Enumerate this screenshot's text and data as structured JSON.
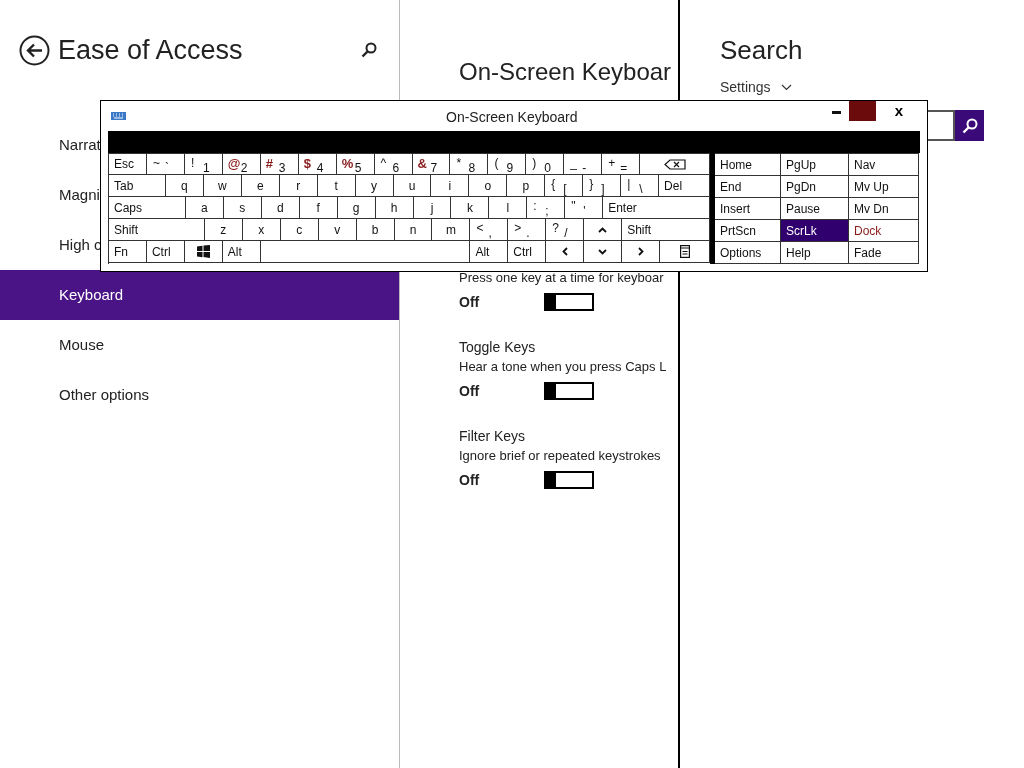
{
  "left_panel": {
    "title": "Ease of Access",
    "items": [
      {
        "label": "Narrat",
        "selected": false
      },
      {
        "label": "Magni",
        "selected": false
      },
      {
        "label": "High c",
        "selected": false
      },
      {
        "label": "Keyboard",
        "selected": true
      },
      {
        "label": "Mouse",
        "selected": false
      },
      {
        "label": "Other options",
        "selected": false
      }
    ]
  },
  "middle_panel": {
    "title": "On-Screen Keyboar",
    "settings": [
      {
        "description": "Press one key at a time for keyboar",
        "state": "Off",
        "on": false
      },
      {
        "name": "Toggle Keys",
        "description": "Hear a tone when you press Caps L",
        "state": "Off",
        "on": false
      },
      {
        "name": "Filter Keys",
        "description": "Ignore brief or repeated keystrokes",
        "state": "Off",
        "on": false
      }
    ]
  },
  "search_panel": {
    "title": "Search",
    "scope": "Settings"
  },
  "osk": {
    "title": "On-Screen Keyboard",
    "close": "x",
    "rows": [
      [
        {
          "kind": "text",
          "label": "Esc"
        },
        {
          "kind": "dual",
          "shift": "~",
          "main": "`"
        },
        {
          "kind": "dual",
          "shift": "!",
          "main": "1"
        },
        {
          "kind": "dual",
          "shift": "@",
          "main": "2",
          "color": "#8b1a1a"
        },
        {
          "kind": "dual",
          "shift": "#",
          "main": "3",
          "color": "#8b1a1a"
        },
        {
          "kind": "dual",
          "shift": "$",
          "main": "4",
          "color": "#8b1a1a"
        },
        {
          "kind": "dual",
          "shift": "%",
          "main": "5",
          "color": "#8b1a1a"
        },
        {
          "kind": "dual",
          "shift": "^",
          "main": "6"
        },
        {
          "kind": "dual",
          "shift": "&",
          "main": "7",
          "color": "#8b1a1a"
        },
        {
          "kind": "dual",
          "shift": "*",
          "main": "8"
        },
        {
          "kind": "dual",
          "shift": "(",
          "main": "9"
        },
        {
          "kind": "dual",
          "shift": ")",
          "main": "0"
        },
        {
          "kind": "dual",
          "shift": "_",
          "main": "-"
        },
        {
          "kind": "dual",
          "shift": "+",
          "main": "="
        },
        {
          "kind": "backspace"
        }
      ],
      [
        {
          "kind": "text",
          "label": "Tab"
        },
        {
          "kind": "char",
          "label": "q"
        },
        {
          "kind": "char",
          "label": "w"
        },
        {
          "kind": "char",
          "label": "e"
        },
        {
          "kind": "char",
          "label": "r"
        },
        {
          "kind": "char",
          "label": "t"
        },
        {
          "kind": "char",
          "label": "y"
        },
        {
          "kind": "char",
          "label": "u"
        },
        {
          "kind": "char",
          "label": "i"
        },
        {
          "kind": "char",
          "label": "o"
        },
        {
          "kind": "char",
          "label": "p"
        },
        {
          "kind": "dual",
          "shift": "{",
          "main": "["
        },
        {
          "kind": "dual",
          "shift": "}",
          "main": "]"
        },
        {
          "kind": "dual",
          "shift": "|",
          "main": "\\"
        },
        {
          "kind": "text",
          "label": "Del"
        }
      ],
      [
        {
          "kind": "text",
          "label": "Caps"
        },
        {
          "kind": "char",
          "label": "a"
        },
        {
          "kind": "char",
          "label": "s"
        },
        {
          "kind": "char",
          "label": "d"
        },
        {
          "kind": "char",
          "label": "f"
        },
        {
          "kind": "char",
          "label": "g"
        },
        {
          "kind": "char",
          "label": "h"
        },
        {
          "kind": "char",
          "label": "j"
        },
        {
          "kind": "char",
          "label": "k"
        },
        {
          "kind": "char",
          "label": "l"
        },
        {
          "kind": "dual",
          "shift": ":",
          "main": ";"
        },
        {
          "kind": "dual",
          "shift": "\"",
          "main": "'"
        },
        {
          "kind": "text",
          "label": "Enter"
        }
      ],
      [
        {
          "kind": "text",
          "label": "Shift"
        },
        {
          "kind": "char",
          "label": "z"
        },
        {
          "kind": "char",
          "label": "x"
        },
        {
          "kind": "char",
          "label": "c"
        },
        {
          "kind": "char",
          "label": "v"
        },
        {
          "kind": "char",
          "label": "b"
        },
        {
          "kind": "char",
          "label": "n"
        },
        {
          "kind": "char",
          "label": "m"
        },
        {
          "kind": "dual",
          "shift": "<",
          "main": ","
        },
        {
          "kind": "dual",
          "shift": ">",
          "main": "."
        },
        {
          "kind": "dual",
          "shift": "?",
          "main": "/"
        },
        {
          "kind": "up"
        },
        {
          "kind": "text",
          "label": "Shift"
        }
      ],
      [
        {
          "kind": "text",
          "label": "Fn"
        },
        {
          "kind": "text",
          "label": "Ctrl"
        },
        {
          "kind": "windows"
        },
        {
          "kind": "text",
          "label": "Alt"
        },
        {
          "kind": "space"
        },
        {
          "kind": "text",
          "label": "Alt"
        },
        {
          "kind": "text",
          "label": "Ctrl"
        },
        {
          "kind": "left"
        },
        {
          "kind": "down"
        },
        {
          "kind": "right"
        },
        {
          "kind": "menu"
        }
      ]
    ],
    "nav_keys": [
      {
        "label": "Home",
        "selected": false
      },
      {
        "label": "PgUp",
        "selected": false
      },
      {
        "label": "Nav",
        "selected": false
      },
      {
        "label": "End",
        "selected": false
      },
      {
        "label": "PgDn",
        "selected": false
      },
      {
        "label": "Mv Up",
        "selected": false
      },
      {
        "label": "Insert",
        "selected": false
      },
      {
        "label": "Pause",
        "selected": false
      },
      {
        "label": "Mv Dn",
        "selected": false
      },
      {
        "label": "PrtScn",
        "selected": false
      },
      {
        "label": "ScrLk",
        "selected": true
      },
      {
        "label": "Dock",
        "selected": false,
        "color": "#8b1a1a"
      },
      {
        "label": "Options",
        "selected": false
      },
      {
        "label": "Help",
        "selected": false
      },
      {
        "label": "Fade",
        "selected": false
      }
    ]
  }
}
